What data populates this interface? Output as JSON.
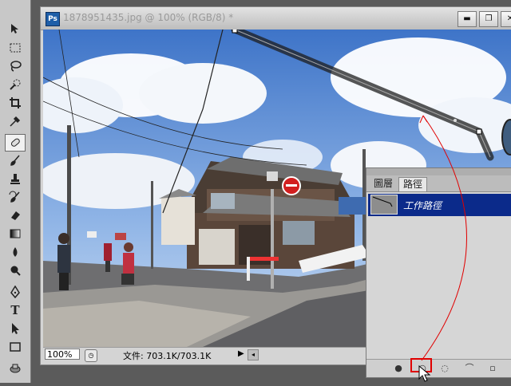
{
  "document": {
    "title": "1878951435.jpg @ 100% (RGB/8) *",
    "app_icon_text": "Ps"
  },
  "window_buttons": {
    "minimize": "▬",
    "restore": "❐",
    "close": "✕"
  },
  "status": {
    "zoom": "100%",
    "file_info": "文件: 703.1K/703.1K",
    "arrow": "▶"
  },
  "panel": {
    "tabs": [
      "圖層",
      "路徑"
    ],
    "active_tab": "路徑",
    "path_item": "工作路徑"
  },
  "tools": [
    {
      "name": "move-tool-icon"
    },
    {
      "name": "marquee-tool-icon"
    },
    {
      "name": "lasso-tool-icon"
    },
    {
      "name": "quick-selection-tool-icon"
    },
    {
      "name": "crop-tool-icon"
    },
    {
      "name": "eyedropper-tool-icon"
    },
    {
      "name": "healing-brush-tool-icon",
      "active": true
    },
    {
      "name": "brush-tool-icon"
    },
    {
      "name": "clone-stamp-tool-icon"
    },
    {
      "name": "history-brush-tool-icon"
    },
    {
      "name": "eraser-tool-icon"
    },
    {
      "name": "gradient-tool-icon"
    },
    {
      "name": "blur-tool-icon"
    },
    {
      "name": "dodge-tool-icon"
    },
    {
      "name": "pen-tool-icon"
    },
    {
      "name": "type-tool-icon"
    },
    {
      "name": "path-selection-tool-icon"
    },
    {
      "name": "shape-tool-icon"
    },
    {
      "name": "hand-tool-icon"
    }
  ],
  "colors": {
    "selection_blue": "#0b2a8a",
    "highlight_red": "#e00000"
  }
}
